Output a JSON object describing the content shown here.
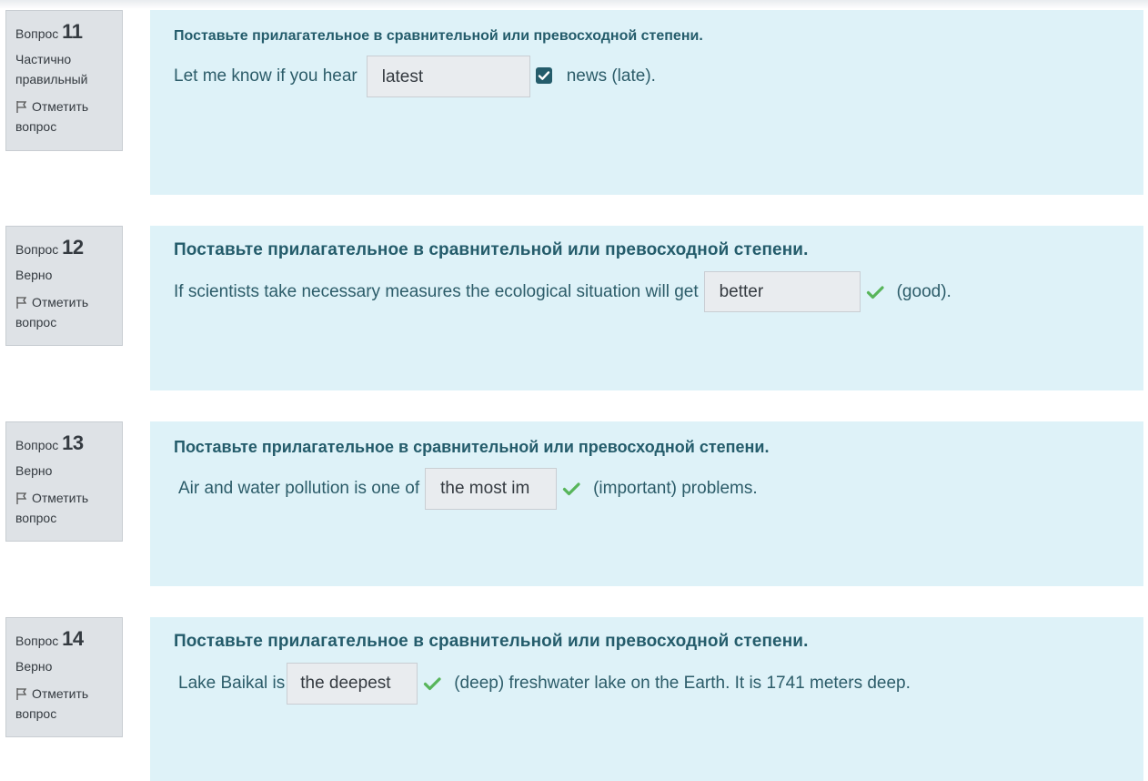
{
  "questions": [
    {
      "label": "Вопрос",
      "number": "11",
      "state": "Частично правильный",
      "flag_label": "Отметить вопрос",
      "instruction": "Поставьте прилагательное в сравнительной или превосходной степени.",
      "before": "Let me know if you hear",
      "answer": "latest",
      "after": "news (late).",
      "mark_icon": "partial-check-icon"
    },
    {
      "label": "Вопрос",
      "number": "12",
      "state": "Верно",
      "flag_label": "Отметить вопрос",
      "instruction": "Поставьте прилагательное в сравнительной или превосходной степени.",
      "before": "If scientists take necessary measures the ecological situation will get",
      "answer": "better",
      "after": "(good).",
      "mark_icon": "correct-check-icon"
    },
    {
      "label": "Вопрос",
      "number": "13",
      "state": "Верно",
      "flag_label": "Отметить вопрос",
      "instruction": "Поставьте прилагательное в сравнительной или превосходной степени.",
      "before": "Air and water pollution is one of",
      "answer": "the most im",
      "after": "(important) problems.",
      "mark_icon": "correct-check-icon"
    },
    {
      "label": "Вопрос",
      "number": "14",
      "state": "Верно",
      "flag_label": "Отметить вопрос",
      "instruction": "Поставьте прилагательное в сравнительной или превосходной степени.",
      "before": "Lake Baikal is",
      "answer": "the deepest",
      "after": "(deep) freshwater lake on the Earth. It is 1741 meters deep.",
      "mark_icon": "correct-check-icon"
    }
  ],
  "colors": {
    "content_bg": "#def2f8",
    "info_bg": "#dee2e6",
    "correct": "#57b55a",
    "partial": "#245c6b"
  }
}
